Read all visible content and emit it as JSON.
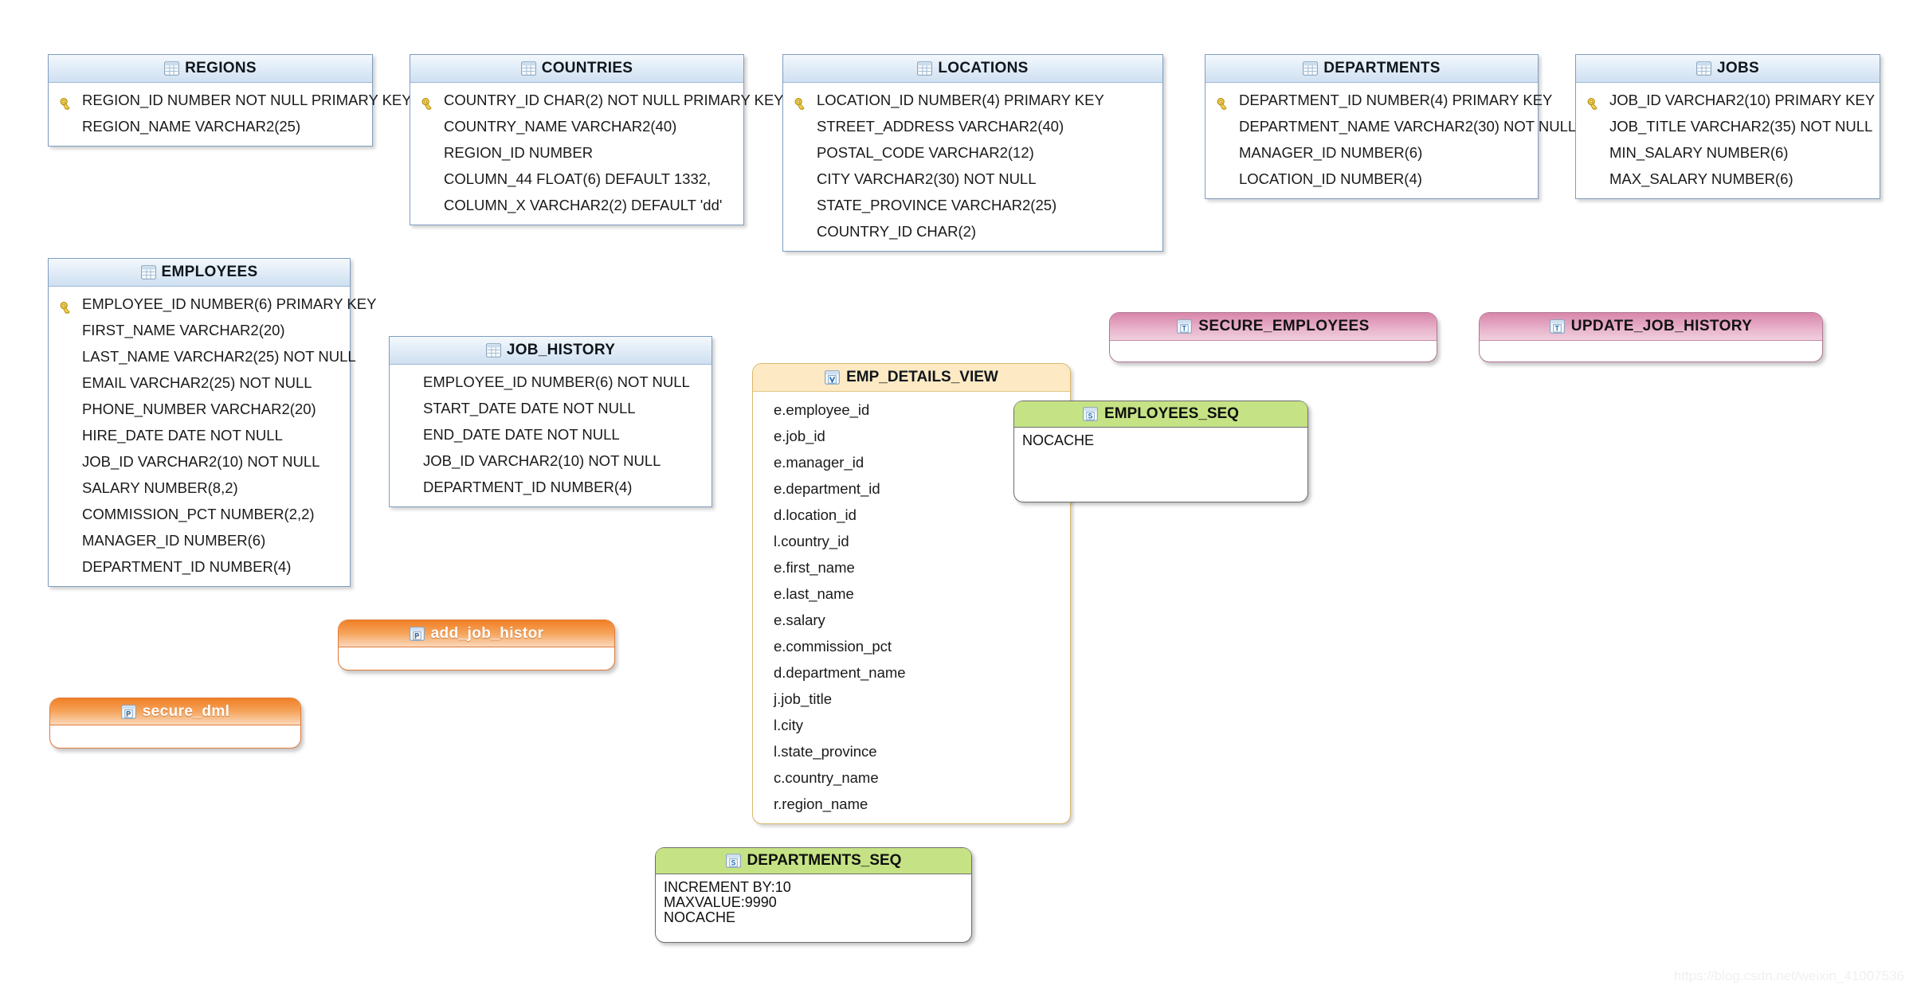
{
  "diagram": {
    "title": "Oracle HR Schema Relational Diagram",
    "watermark": "https://blog.csdn.net/weixin_41007536"
  },
  "colors": {
    "table_header": "#cfe0f1",
    "table_border": "#7f9dc0",
    "view_header": "#fdeac4",
    "view_border": "#d9b66a",
    "sequence_header": "#c5e384",
    "sequence_border": "#6d6d6d",
    "trigger_header": "#d887ab",
    "trigger_border": "#b07794",
    "procedure_header": "#f07f25",
    "procedure_border": "#e07b3a",
    "key_icon": "#f0c419"
  },
  "tables": [
    {
      "name": "REGIONS",
      "icon": "table-icon",
      "columns": [
        {
          "text": "REGION_ID NUMBER NOT NULL PRIMARY KEY",
          "pk": true
        },
        {
          "text": "REGION_NAME VARCHAR2(25)",
          "pk": false
        }
      ]
    },
    {
      "name": "COUNTRIES",
      "icon": "table-icon",
      "columns": [
        {
          "text": "COUNTRY_ID CHAR(2) NOT NULL PRIMARY KEY",
          "pk": true
        },
        {
          "text": "COUNTRY_NAME VARCHAR2(40)",
          "pk": false
        },
        {
          "text": "REGION_ID NUMBER",
          "pk": false
        },
        {
          "text": "COLUMN_44 FLOAT(6) DEFAULT 1332,",
          "pk": false
        },
        {
          "text": "COLUMN_X VARCHAR2(2) DEFAULT 'dd'",
          "pk": false
        }
      ]
    },
    {
      "name": "LOCATIONS",
      "icon": "table-icon",
      "columns": [
        {
          "text": "LOCATION_ID NUMBER(4) PRIMARY KEY",
          "pk": true
        },
        {
          "text": "STREET_ADDRESS VARCHAR2(40)",
          "pk": false
        },
        {
          "text": "POSTAL_CODE VARCHAR2(12)",
          "pk": false
        },
        {
          "text": "CITY VARCHAR2(30) NOT NULL",
          "pk": false
        },
        {
          "text": "STATE_PROVINCE VARCHAR2(25)",
          "pk": false
        },
        {
          "text": "COUNTRY_ID CHAR(2)",
          "pk": false
        }
      ]
    },
    {
      "name": "DEPARTMENTS",
      "icon": "table-icon",
      "columns": [
        {
          "text": "DEPARTMENT_ID NUMBER(4) PRIMARY KEY",
          "pk": true
        },
        {
          "text": "DEPARTMENT_NAME VARCHAR2(30) NOT NULL",
          "pk": false
        },
        {
          "text": "MANAGER_ID NUMBER(6)",
          "pk": false
        },
        {
          "text": "LOCATION_ID NUMBER(4)",
          "pk": false
        }
      ]
    },
    {
      "name": "JOBS",
      "icon": "table-icon",
      "columns": [
        {
          "text": "JOB_ID VARCHAR2(10) PRIMARY KEY",
          "pk": true
        },
        {
          "text": "JOB_TITLE VARCHAR2(35) NOT NULL",
          "pk": false
        },
        {
          "text": "MIN_SALARY NUMBER(6)",
          "pk": false
        },
        {
          "text": "MAX_SALARY NUMBER(6)",
          "pk": false
        }
      ]
    },
    {
      "name": "EMPLOYEES",
      "icon": "table-icon",
      "columns": [
        {
          "text": "EMPLOYEE_ID NUMBER(6) PRIMARY KEY",
          "pk": true
        },
        {
          "text": "FIRST_NAME VARCHAR2(20)",
          "pk": false
        },
        {
          "text": "LAST_NAME VARCHAR2(25) NOT NULL",
          "pk": false
        },
        {
          "text": "EMAIL VARCHAR2(25) NOT NULL",
          "pk": false
        },
        {
          "text": "PHONE_NUMBER VARCHAR2(20)",
          "pk": false
        },
        {
          "text": "HIRE_DATE DATE NOT NULL",
          "pk": false
        },
        {
          "text": "JOB_ID VARCHAR2(10) NOT NULL",
          "pk": false
        },
        {
          "text": "SALARY NUMBER(8,2)",
          "pk": false
        },
        {
          "text": "COMMISSION_PCT NUMBER(2,2)",
          "pk": false
        },
        {
          "text": "MANAGER_ID NUMBER(6)",
          "pk": false
        },
        {
          "text": "DEPARTMENT_ID NUMBER(4)",
          "pk": false
        }
      ]
    },
    {
      "name": "JOB_HISTORY",
      "icon": "table-icon",
      "columns": [
        {
          "text": "EMPLOYEE_ID NUMBER(6) NOT NULL",
          "pk": false
        },
        {
          "text": "START_DATE DATE NOT NULL",
          "pk": false
        },
        {
          "text": "END_DATE DATE NOT NULL",
          "pk": false
        },
        {
          "text": "JOB_ID VARCHAR2(10) NOT NULL",
          "pk": false
        },
        {
          "text": "DEPARTMENT_ID NUMBER(4)",
          "pk": false
        }
      ]
    }
  ],
  "views": [
    {
      "name": "EMP_DETAILS_VIEW",
      "icon": "view-icon",
      "columns": [
        {
          "text": "e.employee_id"
        },
        {
          "text": "e.job_id"
        },
        {
          "text": "e.manager_id"
        },
        {
          "text": "e.department_id"
        },
        {
          "text": "d.location_id"
        },
        {
          "text": "l.country_id"
        },
        {
          "text": "e.first_name"
        },
        {
          "text": "e.last_name"
        },
        {
          "text": "e.salary"
        },
        {
          "text": "e.commission_pct"
        },
        {
          "text": "d.department_name"
        },
        {
          "text": "j.job_title"
        },
        {
          "text": "l.city"
        },
        {
          "text": "l.state_province"
        },
        {
          "text": "c.country_name"
        },
        {
          "text": "r.region_name"
        }
      ]
    }
  ],
  "sequences": [
    {
      "name": "EMPLOYEES_SEQ",
      "icon": "sequence-icon",
      "lines": [
        "NOCACHE"
      ]
    },
    {
      "name": "DEPARTMENTS_SEQ",
      "icon": "sequence-icon",
      "lines": [
        "INCREMENT BY:10",
        "MAXVALUE:9990",
        "NOCACHE"
      ]
    }
  ],
  "triggers": [
    {
      "name": "SECURE_EMPLOYEES",
      "icon": "trigger-icon"
    },
    {
      "name": "UPDATE_JOB_HISTORY",
      "icon": "trigger-icon"
    }
  ],
  "procedures": [
    {
      "name": "add_job_histor",
      "icon": "procedure-icon"
    },
    {
      "name": "secure_dml",
      "icon": "procedure-icon"
    }
  ]
}
